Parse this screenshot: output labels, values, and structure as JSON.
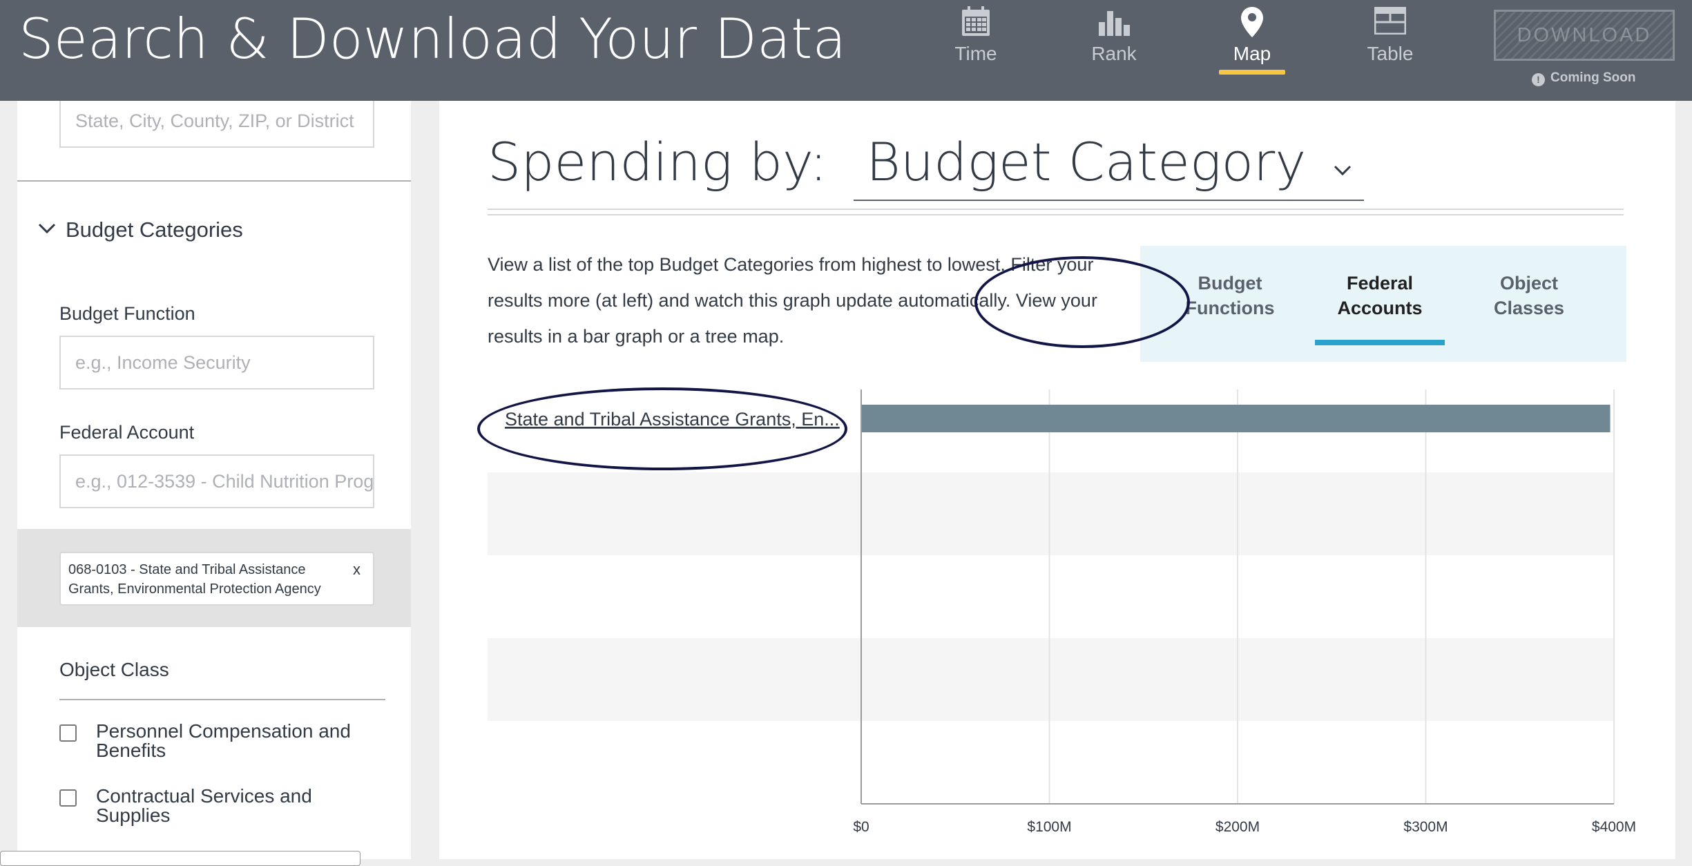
{
  "header": {
    "title": "Search & Download Your Data",
    "nav": [
      {
        "label": "Time",
        "icon": "calendar-icon",
        "active": false
      },
      {
        "label": "Rank",
        "icon": "bar-chart-icon",
        "active": false
      },
      {
        "label": "Map",
        "icon": "map-pin-icon",
        "active": true
      },
      {
        "label": "Table",
        "icon": "table-icon",
        "active": false
      }
    ],
    "download_label": "DOWNLOAD",
    "coming_soon": "Coming Soon",
    "accent_color": "#f9c642"
  },
  "sidebar": {
    "location_placeholder": "State, City, County, ZIP, or District",
    "budget_categories_title": "Budget Categories",
    "budget_function_label": "Budget Function",
    "budget_function_placeholder": "e.g., Income Security",
    "federal_account_label": "Federal Account",
    "federal_account_placeholder": "e.g., 012-3539 - Child Nutrition Prog",
    "selected_account": "068-0103 - State and Tribal Assistance Grants, Environmental Protection Agency",
    "selected_remove": "x",
    "object_class_title": "Object Class",
    "object_classes": [
      {
        "label": "Personnel Compensation and Benefits",
        "checked": false
      },
      {
        "label": "Contractual Services and Supplies",
        "checked": false
      }
    ]
  },
  "main": {
    "spending_by_label": "Spending by:",
    "spending_by_value": "Budget Category",
    "description": "View a list of the top Budget Categories from highest to lowest. Filter your results more (at left) and watch this graph update automatically. View your results in a bar graph or a tree map.",
    "type_buttons": [
      {
        "label": "Budget Functions",
        "active": false
      },
      {
        "label": "Federal Accounts",
        "active": true
      },
      {
        "label": "Object Classes",
        "active": false
      }
    ],
    "type_accent_color": "#2aa3cc"
  },
  "chart_data": {
    "type": "bar",
    "orientation": "horizontal",
    "categories": [
      "State and Tribal Assistance Grants, En..."
    ],
    "values": [
      398000000
    ],
    "xlim": [
      0,
      400000000
    ],
    "x_ticks": [
      "$0",
      "$100M",
      "$200M",
      "$300M",
      "$400M"
    ],
    "x_tick_values": [
      0,
      100000000,
      200000000,
      300000000,
      400000000
    ],
    "row_slots": 5,
    "bar_color": "#708893",
    "grid": true
  }
}
